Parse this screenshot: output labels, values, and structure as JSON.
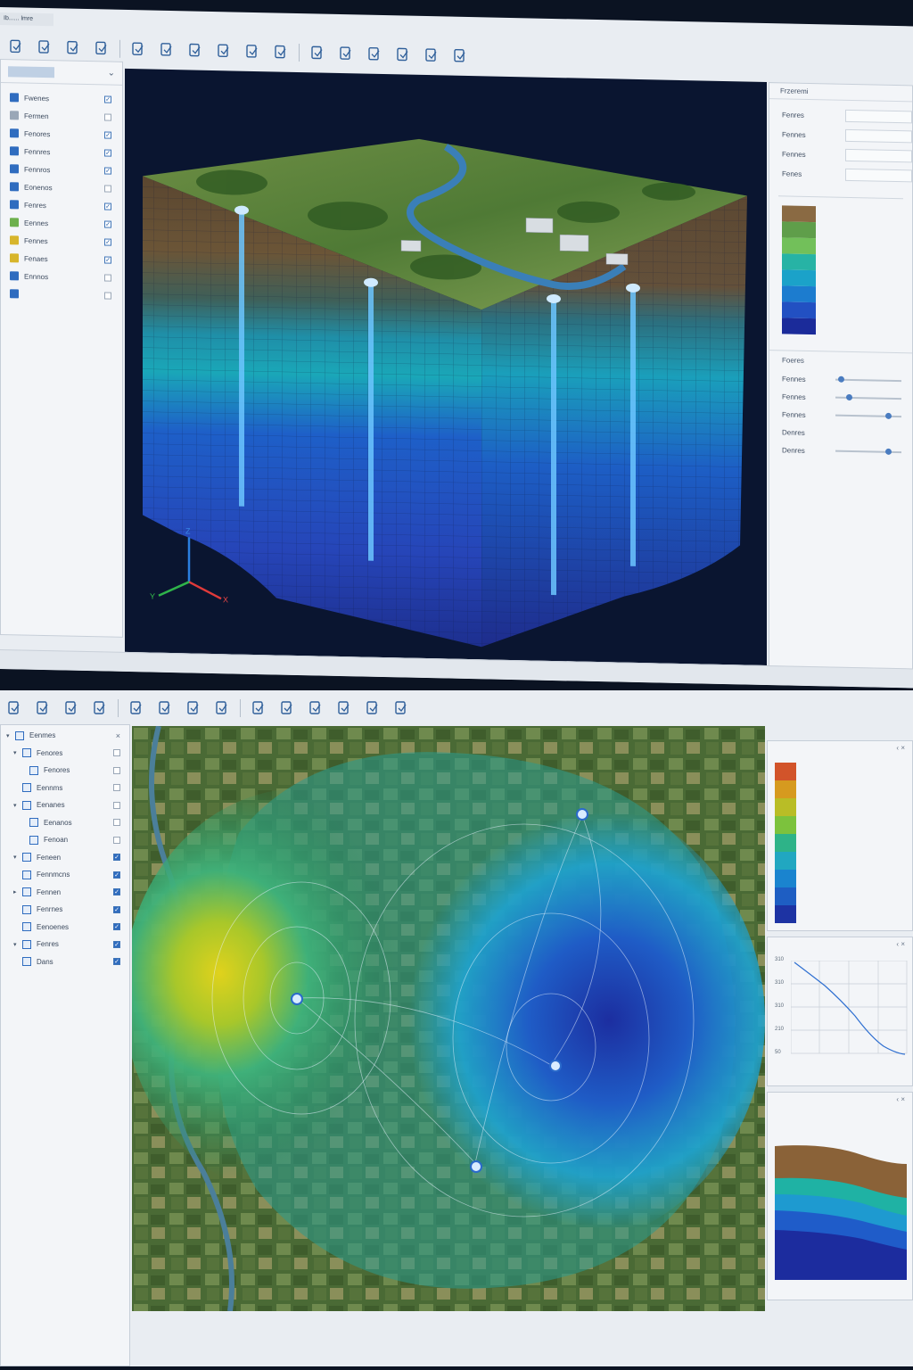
{
  "top_window": {
    "title": "Ib...... lmre",
    "toolbar_icons": [
      "select-icon",
      "document-edit-icon",
      "document-search-icon",
      "document-export-icon",
      "axis-edit-icon",
      "zoom-document-icon",
      "document-tool-icon",
      "pencil-icon",
      "zoom-icon",
      "page-icon",
      "layers-icon",
      "search-magnifier-icon",
      "document-icon",
      "document-copy-icon",
      "document-list-icon",
      "edit-icon"
    ],
    "layer_tree": {
      "items": [
        {
          "label": "Fwenes",
          "checked": true,
          "color": "#2f6cbf"
        },
        {
          "label": "Fermen",
          "checked": false,
          "color": "#9aa7b7"
        },
        {
          "label": "Fenores",
          "checked": true,
          "color": "#2f6cbf"
        },
        {
          "label": "Fennres",
          "checked": true,
          "color": "#2f6cbf"
        },
        {
          "label": "Fennros",
          "checked": true,
          "color": "#2f6cbf"
        },
        {
          "label": "Eonenos",
          "checked": false,
          "color": "#2f6cbf"
        },
        {
          "label": "Fenres",
          "checked": true,
          "color": "#2f6cbf"
        },
        {
          "label": "Eennes",
          "checked": true,
          "color": "#6db04c"
        },
        {
          "label": "Fennes",
          "checked": true,
          "color": "#d7b52b"
        },
        {
          "label": "Fenaes",
          "checked": true,
          "color": "#d7b52b"
        },
        {
          "label": "Ennnos",
          "checked": false,
          "color": "#2f6cbf"
        },
        {
          "label": "",
          "checked": false,
          "color": "#2f6cbf"
        }
      ]
    },
    "properties": {
      "title": "Frzeremi",
      "rows": [
        {
          "label": "Fenres"
        },
        {
          "label": "Fennes"
        },
        {
          "label": "Fennes"
        },
        {
          "label": "Fenes"
        }
      ]
    },
    "stratigraphy_legend": {
      "colors": [
        "#8a6a43",
        "#5f9e4a",
        "#72c05a",
        "#27b3a5",
        "#1ba2c9",
        "#1c7ccf",
        "#2250c2",
        "#1b2b9a"
      ]
    },
    "sliders": {
      "title": "Foeres",
      "rows": [
        {
          "label": "Fennes",
          "value": 0.05
        },
        {
          "label": "Fennes",
          "value": 0.18
        },
        {
          "label": "Fennes",
          "value": 0.82
        },
        {
          "label": "Denres",
          "value": null
        },
        {
          "label": "Denres",
          "value": 0.82
        }
      ]
    },
    "axes": {
      "x": "X",
      "y": "Y",
      "z": "Z"
    }
  },
  "bottom_window": {
    "toolbar_icons": [
      "select-icon",
      "document-search-icon",
      "document-export-icon",
      "document-copy-icon",
      "zoom-document-icon",
      "document-tool-icon",
      "layers-icon",
      "document-edit-icon",
      "axis-edit-icon",
      "page-icon",
      "magic-wand-icon",
      "search-icon",
      "document-icon",
      "document-zoom-icon"
    ],
    "layer_tree": {
      "items": [
        {
          "label": "Eenmes",
          "indent": 0,
          "checked": null,
          "fold": "open"
        },
        {
          "label": "Fenores",
          "indent": 1,
          "checked": false,
          "fold": "open"
        },
        {
          "label": "Fenores",
          "indent": 2,
          "checked": false,
          "fold": ""
        },
        {
          "label": "Eennms",
          "indent": 1,
          "checked": false,
          "fold": ""
        },
        {
          "label": "Eenanes",
          "indent": 1,
          "checked": false,
          "fold": "open"
        },
        {
          "label": "Eenanos",
          "indent": 2,
          "checked": false,
          "fold": ""
        },
        {
          "label": "Fenoan",
          "indent": 2,
          "checked": false,
          "fold": ""
        },
        {
          "label": "Feneen",
          "indent": 1,
          "checked": true,
          "fold": "open"
        },
        {
          "label": "Fennmcns",
          "indent": 1,
          "checked": true,
          "fold": ""
        },
        {
          "label": "Fennen",
          "indent": 1,
          "checked": true,
          "fold": "closed"
        },
        {
          "label": "Fenrnes",
          "indent": 1,
          "checked": true,
          "fold": ""
        },
        {
          "label": "Eenoenes",
          "indent": 1,
          "checked": true,
          "fold": ""
        },
        {
          "label": "Fenres",
          "indent": 1,
          "checked": true,
          "fold": "open"
        },
        {
          "label": "Dans",
          "indent": 1,
          "checked": true,
          "fold": ""
        }
      ]
    },
    "color_scale": {
      "colors": [
        "#d2542a",
        "#d69a1f",
        "#b9bd26",
        "#7cc23d",
        "#2eb388",
        "#21a7c1",
        "#1a84cf",
        "#1e5ec3",
        "#1d33a3"
      ]
    },
    "line_chart": {
      "y_ticks": [
        "310",
        "310",
        "310",
        "210",
        "50"
      ]
    },
    "section_chart": {
      "colors": [
        "#8a6238",
        "#1fb2a4",
        "#1e9ad0",
        "#1f5cc9",
        "#1c2c9e"
      ]
    }
  }
}
